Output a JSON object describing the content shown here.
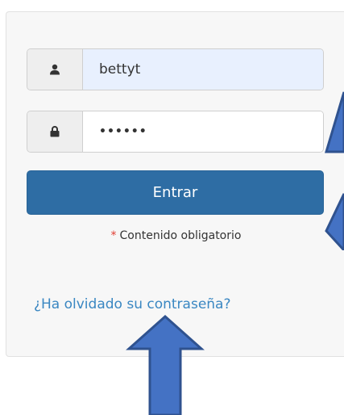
{
  "login": {
    "username_value": "bettyt",
    "password_value": "••••••",
    "submit_label": "Entrar",
    "required_marker": "*",
    "required_text": "Contenido obligatorio",
    "forgot_link": "¿Ha olvidado su contraseña?"
  },
  "icons": {
    "username_addon": "user-icon",
    "password_addon": "lock-icon"
  },
  "colors": {
    "button": "#2e6da4",
    "link": "#3a87c2",
    "required_star": "#e03c31",
    "annotation_arrow": "#4472c4"
  }
}
